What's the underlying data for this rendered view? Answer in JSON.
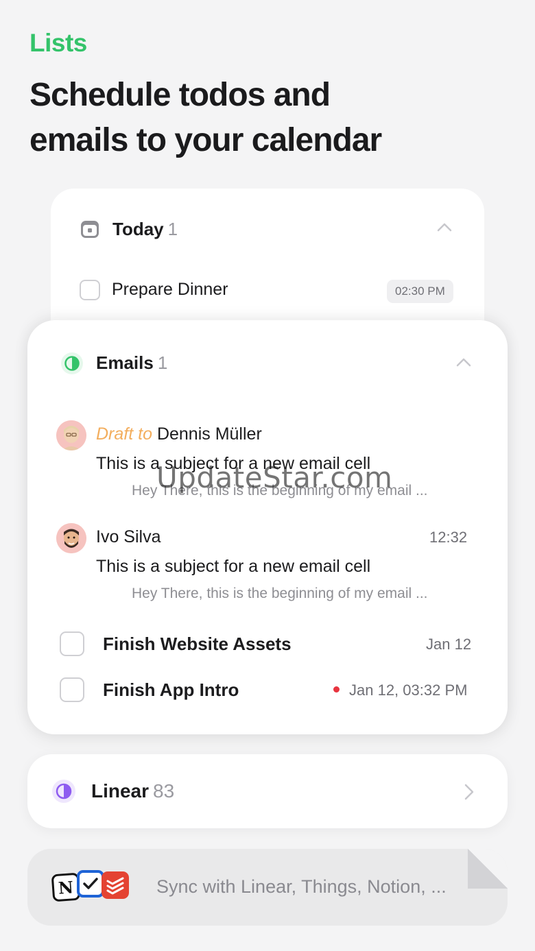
{
  "header": {
    "eyebrow": "Lists",
    "headline_line1": "Schedule todos and",
    "headline_line2": "emails to your calendar"
  },
  "today": {
    "title": "Today",
    "count": "1",
    "icon": "calendar-day-icon",
    "tasks": [
      {
        "label": "Prepare Dinner",
        "time": "02:30 PM"
      }
    ]
  },
  "emails": {
    "title": "Emails",
    "count": "1",
    "icon": "half-circle-green-icon",
    "items": [
      {
        "draft_prefix": "Draft to",
        "name": "Dennis Müller",
        "subject": "This is a subject for a new email cell",
        "preview": "Hey There, this is the beginning of my email ...",
        "time": ""
      },
      {
        "draft_prefix": "",
        "name": "Ivo Silva",
        "subject": "This is a subject for a new email cell",
        "preview": "Hey There, this is the beginning of my email ...",
        "time": "12:32"
      }
    ],
    "tasks": [
      {
        "label": "Finish Website Assets",
        "date": "Jan 12",
        "overdue": false
      },
      {
        "label": "Finish App Intro",
        "date": "Jan 12, 03:32 PM",
        "overdue": true
      }
    ]
  },
  "linear": {
    "title": "Linear",
    "count": "83",
    "icon": "half-circle-purple-icon"
  },
  "sync": {
    "text": "Sync with Linear, Things, Notion, ...",
    "apps": [
      "notion-icon",
      "things-icon",
      "todoist-icon"
    ]
  },
  "watermark": "UpdateStar.com",
  "colors": {
    "accent_green": "#34c36a",
    "draft_orange": "#f3ae5e",
    "linear_purple": "#8e5cf0",
    "overdue_red": "#e8343f"
  }
}
